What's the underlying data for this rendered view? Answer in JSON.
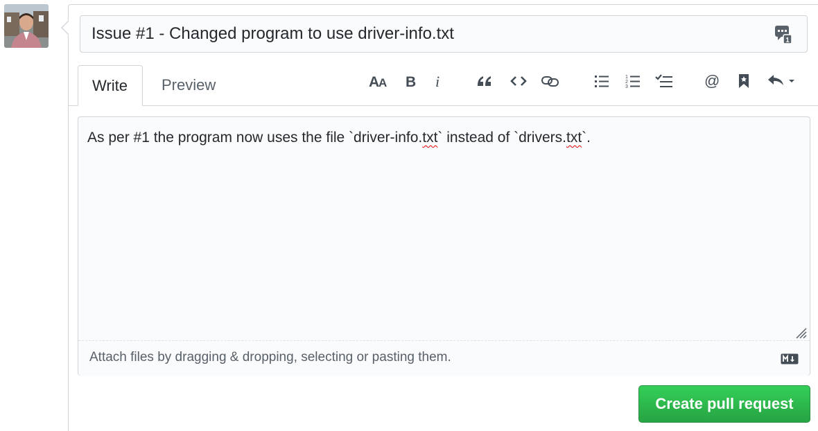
{
  "form": {
    "title_value": "Issue #1 - Changed program to use driver-info.txt",
    "tabs": [
      {
        "label": "Write",
        "active": true
      },
      {
        "label": "Preview",
        "active": false
      }
    ],
    "toolbar": [
      {
        "icon": "text-size-icon"
      },
      {
        "icon": "bold-icon"
      },
      {
        "icon": "italic-icon"
      },
      {
        "icon": "quote-icon"
      },
      {
        "icon": "code-icon"
      },
      {
        "icon": "link-icon"
      },
      {
        "icon": "unordered-list-icon"
      },
      {
        "icon": "ordered-list-icon"
      },
      {
        "icon": "task-list-icon"
      },
      {
        "icon": "mention-icon"
      },
      {
        "icon": "bookmark-icon"
      },
      {
        "icon": "reply-icon"
      }
    ],
    "body": {
      "segments": [
        "As per #1 the program now uses the file `driver-info.",
        "txt",
        "` instead of `drivers.",
        "txt",
        "`."
      ]
    },
    "attach_text": "Attach files by dragging & dropping, selecting or pasting them.",
    "submit_label": "Create pull request"
  },
  "colors": {
    "primary_green": "#28a745",
    "border": "#d1d5da",
    "field_background": "#fafbfc",
    "muted_text": "#586069"
  }
}
